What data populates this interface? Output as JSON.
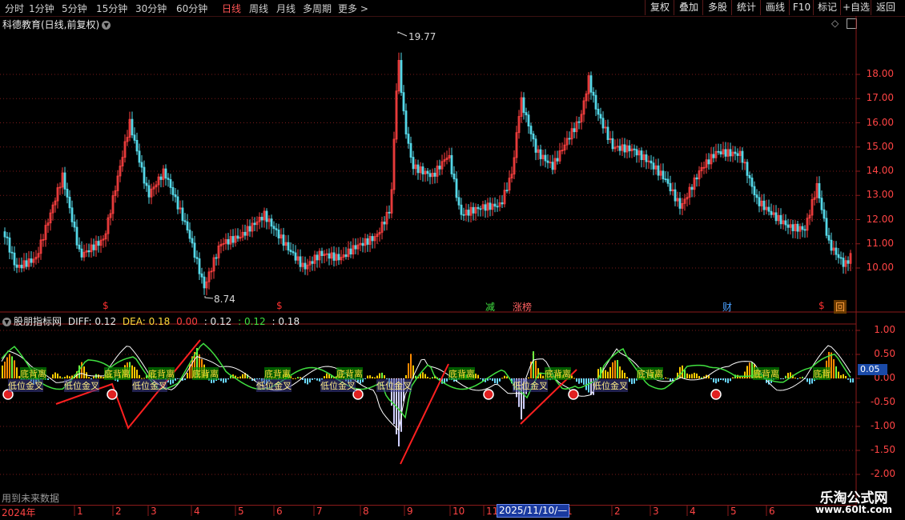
{
  "toolbar": {
    "periods": [
      "分时",
      "1分钟",
      "5分钟",
      "15分钟",
      "30分钟",
      "60分钟",
      "日线",
      "周线",
      "月线",
      "多周期",
      "更多 >"
    ],
    "active_period": "日线",
    "buttons": [
      "复权",
      "叠加",
      "多股",
      "统计",
      "画线",
      "F10",
      "标记",
      "+自选",
      "返回"
    ]
  },
  "chart": {
    "title": "科德教育(日线,前复权)",
    "controls": [
      "◇",
      "‹"
    ],
    "high_label": "19.77",
    "low_label": "8.74",
    "price_ticks": [
      "18.00",
      "17.00",
      "16.00",
      "15.00",
      "14.00",
      "13.00",
      "12.00",
      "11.00",
      "10.00"
    ],
    "event_markers": [
      {
        "text": "$",
        "color": "#ff3030"
      },
      {
        "text": "$",
        "color": "#ff3030"
      },
      {
        "text": "减",
        "color": "#40e040"
      },
      {
        "text": "涨榜",
        "color": "#ff6060"
      },
      {
        "text": "财",
        "color": "#4aa0ff"
      },
      {
        "text": "$",
        "color": "#ff3030"
      },
      {
        "text": "回",
        "color": "#ffa040"
      }
    ]
  },
  "indicator": {
    "name": "股朋指标网",
    "diff_label": "DIFF: 0.12",
    "dea_label": "DEA: 0.18",
    "v1": "0.00",
    "v2": ": 0.12",
    "v3": ": 0.12",
    "v4": ": 0.18",
    "ticks": [
      "1.00",
      "0.50",
      "0.00",
      "-0.50",
      "-1.00",
      "-1.50",
      "-2.00"
    ],
    "current_value": "0.05",
    "signal_labels": [
      "底背离",
      "底背离",
      "底背离",
      "底背离",
      "底背离",
      "底背离",
      "底背离",
      "底背离",
      "底背离",
      "底背离",
      "底背"
    ],
    "cross_labels": [
      "低位金叉",
      "低位金叉",
      "低位金叉",
      "低位金叉",
      "低位金叉",
      "低位金叉",
      "低位金叉",
      "低位金叉"
    ]
  },
  "footnote": "用到未来数据",
  "dates": {
    "labels": [
      "2024年",
      "1",
      "2",
      "3",
      "4",
      "5",
      "6",
      "7",
      "8",
      "9",
      "10",
      "11",
      "1",
      "2",
      "3",
      "4",
      "5",
      "6"
    ],
    "cursor": "2025/11/10/—"
  },
  "watermark": {
    "line1": "乐淘公式网",
    "line2": "www.60lt.com"
  },
  "colors": {
    "up": "#ff4040",
    "down": "#54d8e8",
    "grid": "#7a1a1a",
    "axis": "#ff4444",
    "diff": "#ffffff",
    "dea": "#40e040",
    "bar_pos": "#ffcc00",
    "bar_neg": "#6ad8ff"
  }
}
